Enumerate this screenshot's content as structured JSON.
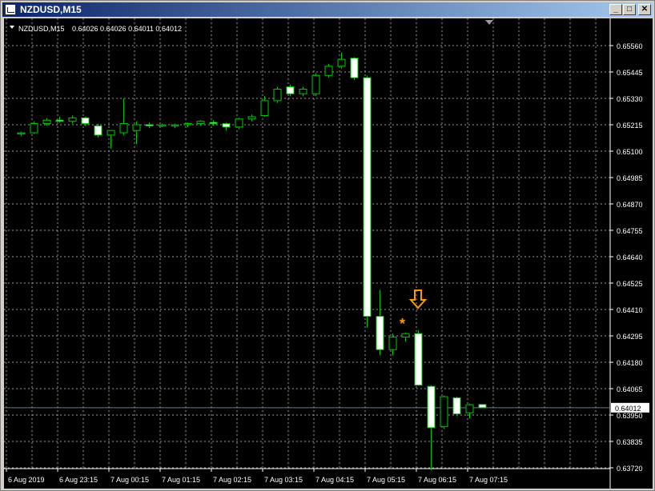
{
  "window": {
    "title": "NZDUSD,M15",
    "min_glyph": "_",
    "max_glyph": "□",
    "close_glyph": "✕"
  },
  "header": {
    "symbol": "NZDUSD,M15",
    "ohlc": "0.64026 0.64026 0.64011 0.64012"
  },
  "colors": {
    "background": "#000000",
    "grid": "#9a9a9a",
    "axis_text": "#ffffff",
    "candle_outline": "#00c800",
    "bull_fill": "#000000",
    "bear_fill": "#ffffff",
    "price_line": "#5f7f8f",
    "signal": "#ff9900"
  },
  "price_axis": {
    "labels": [
      "0.65560",
      "0.65445",
      "0.65330",
      "0.65215",
      "0.65100",
      "0.64985",
      "0.64870",
      "0.64755",
      "0.64640",
      "0.64525",
      "0.64410",
      "0.64295",
      "0.64180",
      "0.64065",
      "0.63950",
      "0.63835",
      "0.63720"
    ],
    "current": "0.64012"
  },
  "time_axis": {
    "labels": [
      "6 Aug 2019",
      "6 Aug 23:15",
      "7 Aug 00:15",
      "7 Aug 01:15",
      "7 Aug 02:15",
      "7 Aug 03:15",
      "7 Aug 04:15",
      "7 Aug 05:15",
      "7 Aug 06:15",
      "7 Aug 07:15"
    ]
  },
  "chart_data": {
    "type": "candlestick",
    "symbol": "NZDUSD",
    "timeframe": "M15",
    "ylim": [
      0.6372,
      0.6559
    ],
    "current_price": 0.64012,
    "candles": [
      {
        "o": 0.65205,
        "h": 0.65215,
        "l": 0.65195,
        "c": 0.6521
      },
      {
        "o": 0.6521,
        "h": 0.6526,
        "l": 0.65205,
        "c": 0.6525
      },
      {
        "o": 0.6525,
        "h": 0.65275,
        "l": 0.6524,
        "c": 0.65265
      },
      {
        "o": 0.65265,
        "h": 0.6528,
        "l": 0.65255,
        "c": 0.6526
      },
      {
        "o": 0.6526,
        "h": 0.65285,
        "l": 0.6525,
        "c": 0.65275
      },
      {
        "o": 0.65275,
        "h": 0.6528,
        "l": 0.6524,
        "c": 0.6525
      },
      {
        "o": 0.6524,
        "h": 0.6525,
        "l": 0.6519,
        "c": 0.652
      },
      {
        "o": 0.652,
        "h": 0.6522,
        "l": 0.6514,
        "c": 0.6522
      },
      {
        "o": 0.6521,
        "h": 0.6536,
        "l": 0.652,
        "c": 0.6525
      },
      {
        "o": 0.6522,
        "h": 0.6526,
        "l": 0.6516,
        "c": 0.65245
      },
      {
        "o": 0.65245,
        "h": 0.65255,
        "l": 0.6523,
        "c": 0.6524
      },
      {
        "o": 0.6524,
        "h": 0.6525,
        "l": 0.65235,
        "c": 0.65245
      },
      {
        "o": 0.6524,
        "h": 0.6525,
        "l": 0.6523,
        "c": 0.65245
      },
      {
        "o": 0.65245,
        "h": 0.65255,
        "l": 0.65235,
        "c": 0.6525
      },
      {
        "o": 0.6525,
        "h": 0.65265,
        "l": 0.6524,
        "c": 0.6526
      },
      {
        "o": 0.65255,
        "h": 0.65265,
        "l": 0.6524,
        "c": 0.6525
      },
      {
        "o": 0.6525,
        "h": 0.65255,
        "l": 0.6522,
        "c": 0.65235
      },
      {
        "o": 0.65235,
        "h": 0.65275,
        "l": 0.65225,
        "c": 0.6527
      },
      {
        "o": 0.6527,
        "h": 0.6529,
        "l": 0.6526,
        "c": 0.6528
      },
      {
        "o": 0.65285,
        "h": 0.6537,
        "l": 0.6528,
        "c": 0.6535
      },
      {
        "o": 0.6535,
        "h": 0.6541,
        "l": 0.6534,
        "c": 0.654
      },
      {
        "o": 0.6541,
        "h": 0.6542,
        "l": 0.6537,
        "c": 0.6538
      },
      {
        "o": 0.6538,
        "h": 0.6541,
        "l": 0.6537,
        "c": 0.654
      },
      {
        "o": 0.6538,
        "h": 0.6547,
        "l": 0.6537,
        "c": 0.6546
      },
      {
        "o": 0.6546,
        "h": 0.6551,
        "l": 0.6545,
        "c": 0.655
      },
      {
        "o": 0.655,
        "h": 0.6556,
        "l": 0.6549,
        "c": 0.6553
      },
      {
        "o": 0.65535,
        "h": 0.6554,
        "l": 0.6544,
        "c": 0.6545
      },
      {
        "o": 0.6545,
        "h": 0.6546,
        "l": 0.6436,
        "c": 0.6441
      },
      {
        "o": 0.6441,
        "h": 0.64525,
        "l": 0.6424,
        "c": 0.64265
      },
      {
        "o": 0.64265,
        "h": 0.64335,
        "l": 0.6424,
        "c": 0.6432
      },
      {
        "o": 0.6432,
        "h": 0.6434,
        "l": 0.643,
        "c": 0.64335
      },
      {
        "o": 0.64335,
        "h": 0.6435,
        "l": 0.6411,
        "c": 0.6411
      },
      {
        "o": 0.64105,
        "h": 0.6411,
        "l": 0.6374,
        "c": 0.63925
      },
      {
        "o": 0.6393,
        "h": 0.64065,
        "l": 0.6392,
        "c": 0.6406
      },
      {
        "o": 0.64055,
        "h": 0.6406,
        "l": 0.63975,
        "c": 0.63985
      },
      {
        "o": 0.6399,
        "h": 0.6403,
        "l": 0.63965,
        "c": 0.64025
      },
      {
        "o": 0.64026,
        "h": 0.64026,
        "l": 0.64011,
        "c": 0.64012
      }
    ],
    "annotations": [
      {
        "type": "star",
        "candle_index": 30,
        "price": 0.64385
      },
      {
        "type": "down-arrow",
        "candle_index": 31,
        "price": 0.6444
      }
    ]
  }
}
